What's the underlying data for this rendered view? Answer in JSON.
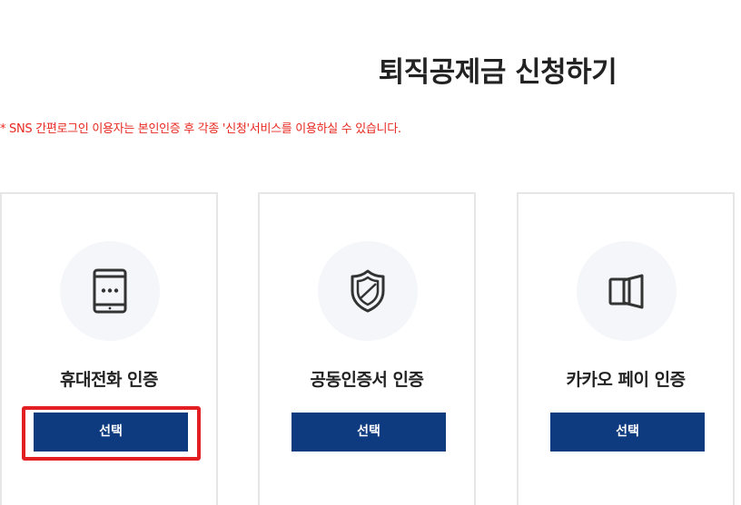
{
  "page": {
    "title": "퇴직공제금 신청하기",
    "notice": "* SNS 간편로그인 이용자는 본인인증 후 각종 '신청'서비스를 이용하실 수 있습니다."
  },
  "cards": [
    {
      "title": "휴대전화 인증",
      "button_label": "선택",
      "icon": "mobile-phone-icon"
    },
    {
      "title": "공동인증서 인증",
      "button_label": "선택",
      "icon": "shield-certificate-icon"
    },
    {
      "title": "카카오 페이 인증",
      "button_label": "선택",
      "icon": "kakao-pay-icon"
    }
  ],
  "colors": {
    "button_bg": "#0e3a80",
    "notice_text": "#e8281f",
    "highlight": "#e41f24",
    "icon_circle": "#f5f6fa"
  }
}
